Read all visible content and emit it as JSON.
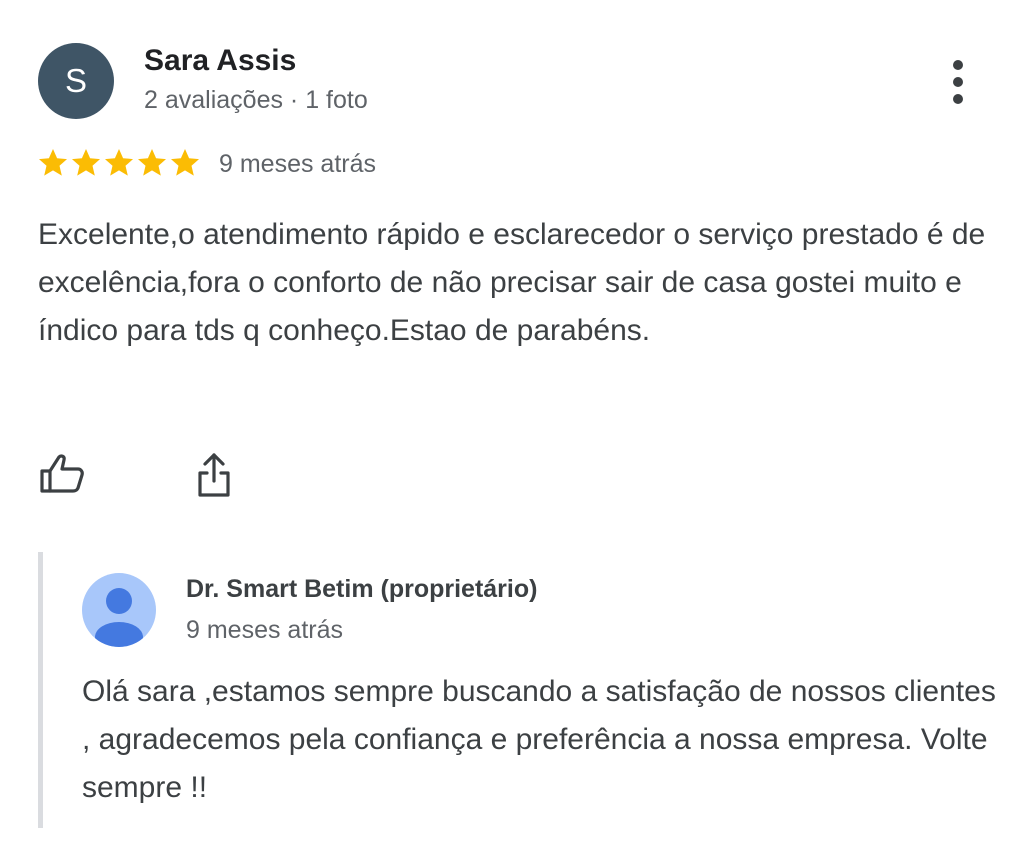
{
  "review": {
    "avatar_initial": "S",
    "reviewer_name": "Sara Assis",
    "reviewer_meta": "2 avaliações · 1 foto",
    "rating": 5,
    "rating_max": 5,
    "date": "9 meses atrás",
    "text": "Excelente,o atendimento rápido e esclarecedor o serviço prestado é de excelência,fora o conforto de não precisar sair de casa gostei muito e índico para tds q conheço.Estao de parabéns.",
    "more_icon": "more-vert-icon",
    "like_icon": "thumb-up-icon",
    "share_icon": "share-icon"
  },
  "reply": {
    "owner_icon": "person-icon",
    "owner_name": "Dr. Smart Betim (proprietário)",
    "date": "9 meses atrás",
    "text": "Olá sara ,estamos sempre buscando a satisfação de nossos clientes , agradecemos pela confiança e preferência a nossa empresa. Volte sempre !!"
  },
  "colors": {
    "star": "#fbbc04",
    "avatar_bg": "#3f5566",
    "owner_avatar_bg": "#a8c7fa",
    "owner_avatar_fg": "#4479e0",
    "reply_border": "#dadce0"
  }
}
